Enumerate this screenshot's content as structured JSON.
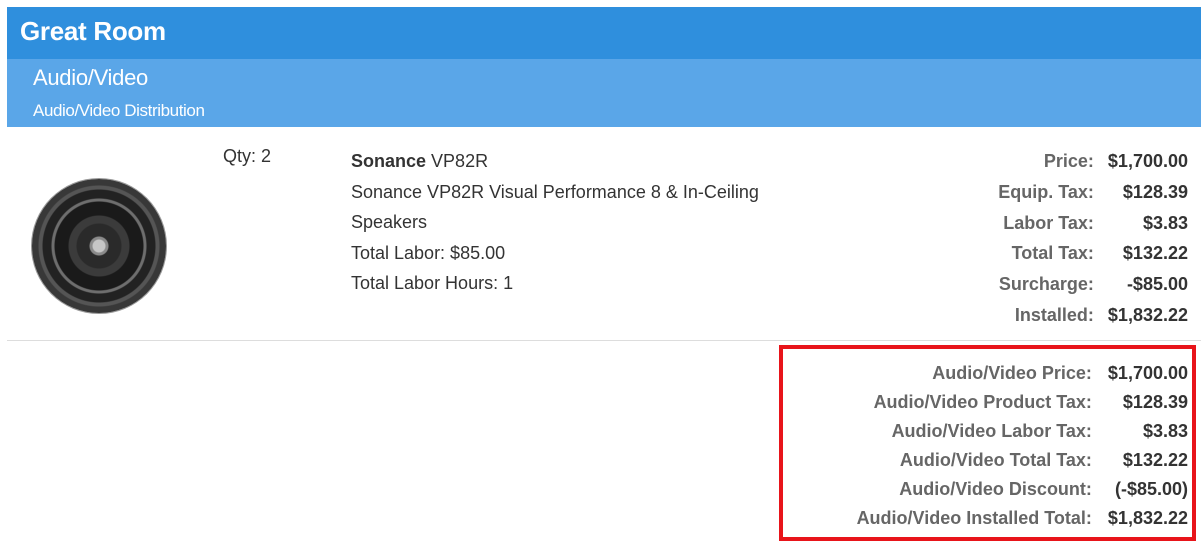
{
  "room": {
    "title": "Great Room"
  },
  "category": {
    "title": "Audio/Video",
    "subtitle": "Audio/Video Distribution"
  },
  "item": {
    "image_icon": "in-ceiling-speaker",
    "qty": "Qty: 2",
    "brand": "Sonance",
    "model": "VP82R",
    "description_line1": "Sonance VP82R Visual Performance 8 & In-Ceiling",
    "description_line2": "Speakers",
    "total_labor": "Total Labor: $85.00",
    "total_labor_hours": "Total Labor Hours: 1",
    "pricing": [
      {
        "label": "Price:",
        "value": "$1,700.00"
      },
      {
        "label": "Equip. Tax:",
        "value": "$128.39"
      },
      {
        "label": "Labor Tax:",
        "value": "$3.83"
      },
      {
        "label": "Total Tax:",
        "value": "$132.22"
      },
      {
        "label": "Surcharge:",
        "value": "-$85.00"
      },
      {
        "label": "Installed:",
        "value": "$1,832.22"
      }
    ]
  },
  "summary": {
    "highlight_color": "#e8141a",
    "rows": [
      {
        "label": "Audio/Video Price:",
        "value": "$1,700.00"
      },
      {
        "label": "Audio/Video Product Tax:",
        "value": "$128.39"
      },
      {
        "label": "Audio/Video Labor Tax:",
        "value": "$3.83"
      },
      {
        "label": "Audio/Video Total Tax:",
        "value": "$132.22"
      },
      {
        "label": "Audio/Video Discount:",
        "value": "(-$85.00)"
      },
      {
        "label": "Audio/Video Installed Total:",
        "value": "$1,832.22"
      }
    ]
  },
  "colors": {
    "room_header": "#2f8fdd",
    "category_header": "#5aa6e8"
  }
}
